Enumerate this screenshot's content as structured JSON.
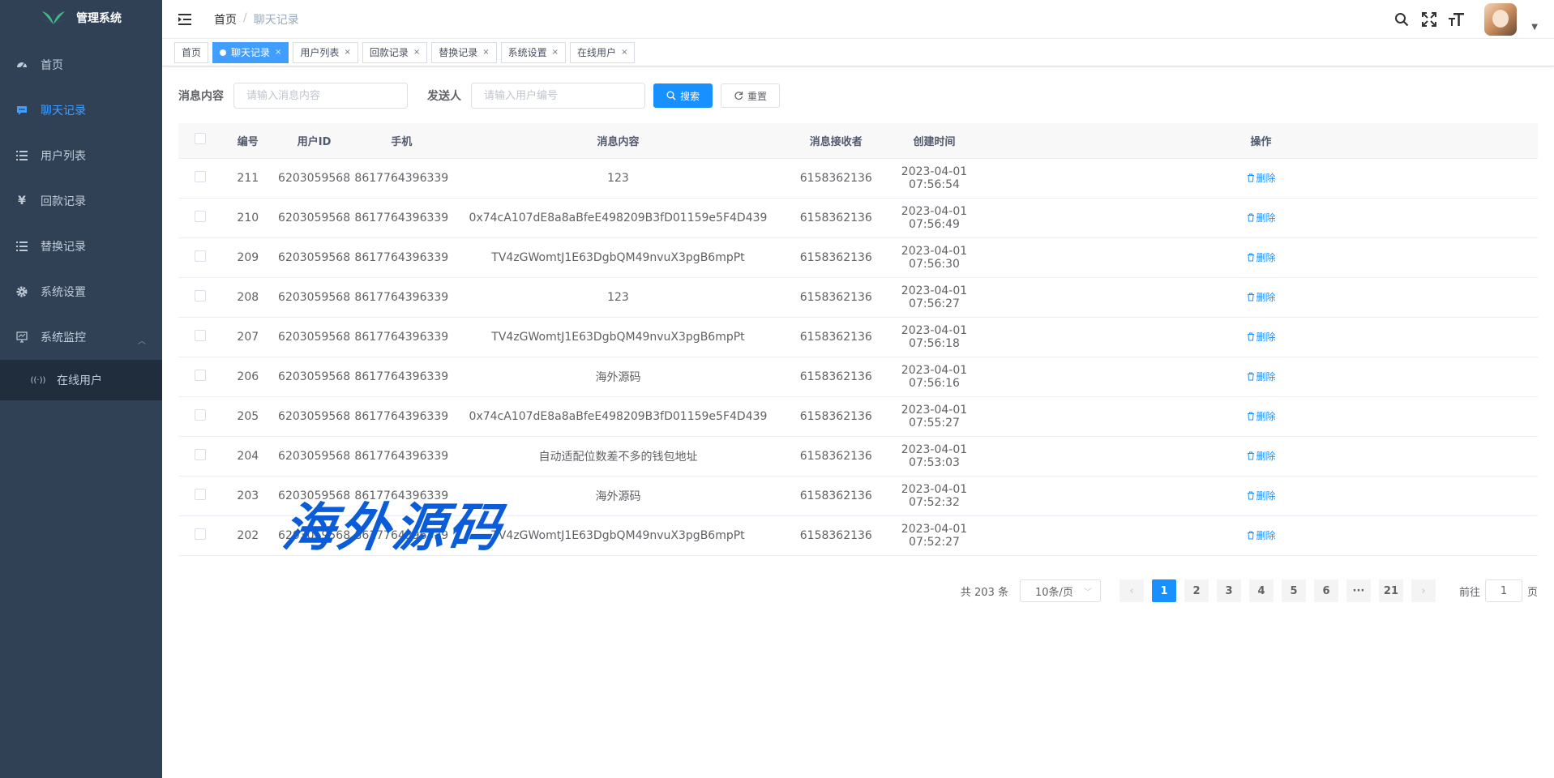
{
  "sidebar": {
    "logo_title": "管理系统",
    "items": [
      {
        "label": "首页",
        "icon": "dashboard-icon"
      },
      {
        "label": "聊天记录",
        "icon": "chat-icon"
      },
      {
        "label": "用户列表",
        "icon": "list-icon"
      },
      {
        "label": "回款记录",
        "icon": "yen-icon"
      },
      {
        "label": "替换记录",
        "icon": "list-icon"
      },
      {
        "label": "系统设置",
        "icon": "gear-icon"
      },
      {
        "label": "系统监控",
        "icon": "monitor-icon"
      }
    ],
    "submenu": [
      {
        "label": "在线用户",
        "icon": "online-icon"
      }
    ]
  },
  "navbar": {
    "breadcrumb": [
      "首页",
      "/",
      "聊天记录"
    ]
  },
  "tags": [
    {
      "label": "首页"
    },
    {
      "label": "聊天记录"
    },
    {
      "label": "用户列表"
    },
    {
      "label": "回款记录"
    },
    {
      "label": "替换记录"
    },
    {
      "label": "系统设置"
    },
    {
      "label": "在线用户"
    }
  ],
  "search": {
    "content_label": "消息内容",
    "content_placeholder": "请输入消息内容",
    "sender_label": "发送人",
    "sender_placeholder": "请输入用户编号",
    "search_btn": "搜索",
    "reset_btn": "重置"
  },
  "table": {
    "headers": [
      "编号",
      "用户ID",
      "手机",
      "消息内容",
      "消息接收者",
      "创建时间",
      "操作"
    ],
    "delete_label": "删除",
    "rows": [
      [
        "211",
        "6203059568",
        "8617764396339",
        "123",
        "6158362136",
        "2023-04-01 07:56:54"
      ],
      [
        "210",
        "6203059568",
        "8617764396339",
        "0x74cA107dE8a8aBfeE498209B3fD01159e5F4D439",
        "6158362136",
        "2023-04-01 07:56:49"
      ],
      [
        "209",
        "6203059568",
        "8617764396339",
        "TV4zGWomtJ1E63DgbQM49nvuX3pgB6mpPt",
        "6158362136",
        "2023-04-01 07:56:30"
      ],
      [
        "208",
        "6203059568",
        "8617764396339",
        "123",
        "6158362136",
        "2023-04-01 07:56:27"
      ],
      [
        "207",
        "6203059568",
        "8617764396339",
        "TV4zGWomtJ1E63DgbQM49nvuX3pgB6mpPt",
        "6158362136",
        "2023-04-01 07:56:18"
      ],
      [
        "206",
        "6203059568",
        "8617764396339",
        "海外源码",
        "6158362136",
        "2023-04-01 07:56:16"
      ],
      [
        "205",
        "6203059568",
        "8617764396339",
        "0x74cA107dE8a8aBfeE498209B3fD01159e5F4D439",
        "6158362136",
        "2023-04-01 07:55:27"
      ],
      [
        "204",
        "6203059568",
        "8617764396339",
        "自动适配位数差不多的钱包地址",
        "6158362136",
        "2023-04-01 07:53:03"
      ],
      [
        "203",
        "6203059568",
        "8617764396339",
        "海外源码",
        "6158362136",
        "2023-04-01 07:52:32"
      ],
      [
        "202",
        "6203059568",
        "8617764396339",
        "TV4zGWomtJ1E63DgbQM49nvuX3pgB6mpPt",
        "6158362136",
        "2023-04-01 07:52:27"
      ]
    ]
  },
  "pagination": {
    "total": "共 203 条",
    "page_size": "10条/页",
    "pages": [
      "1",
      "2",
      "3",
      "4",
      "5",
      "6",
      "···",
      "21"
    ],
    "current": "1",
    "goto_prefix": "前往",
    "goto_value": "1",
    "goto_suffix": "页"
  },
  "watermark": "海外源码",
  "colors": {
    "sidebar_bg": "#304156",
    "primary": "#1890ff",
    "active_menu": "#409eff"
  }
}
